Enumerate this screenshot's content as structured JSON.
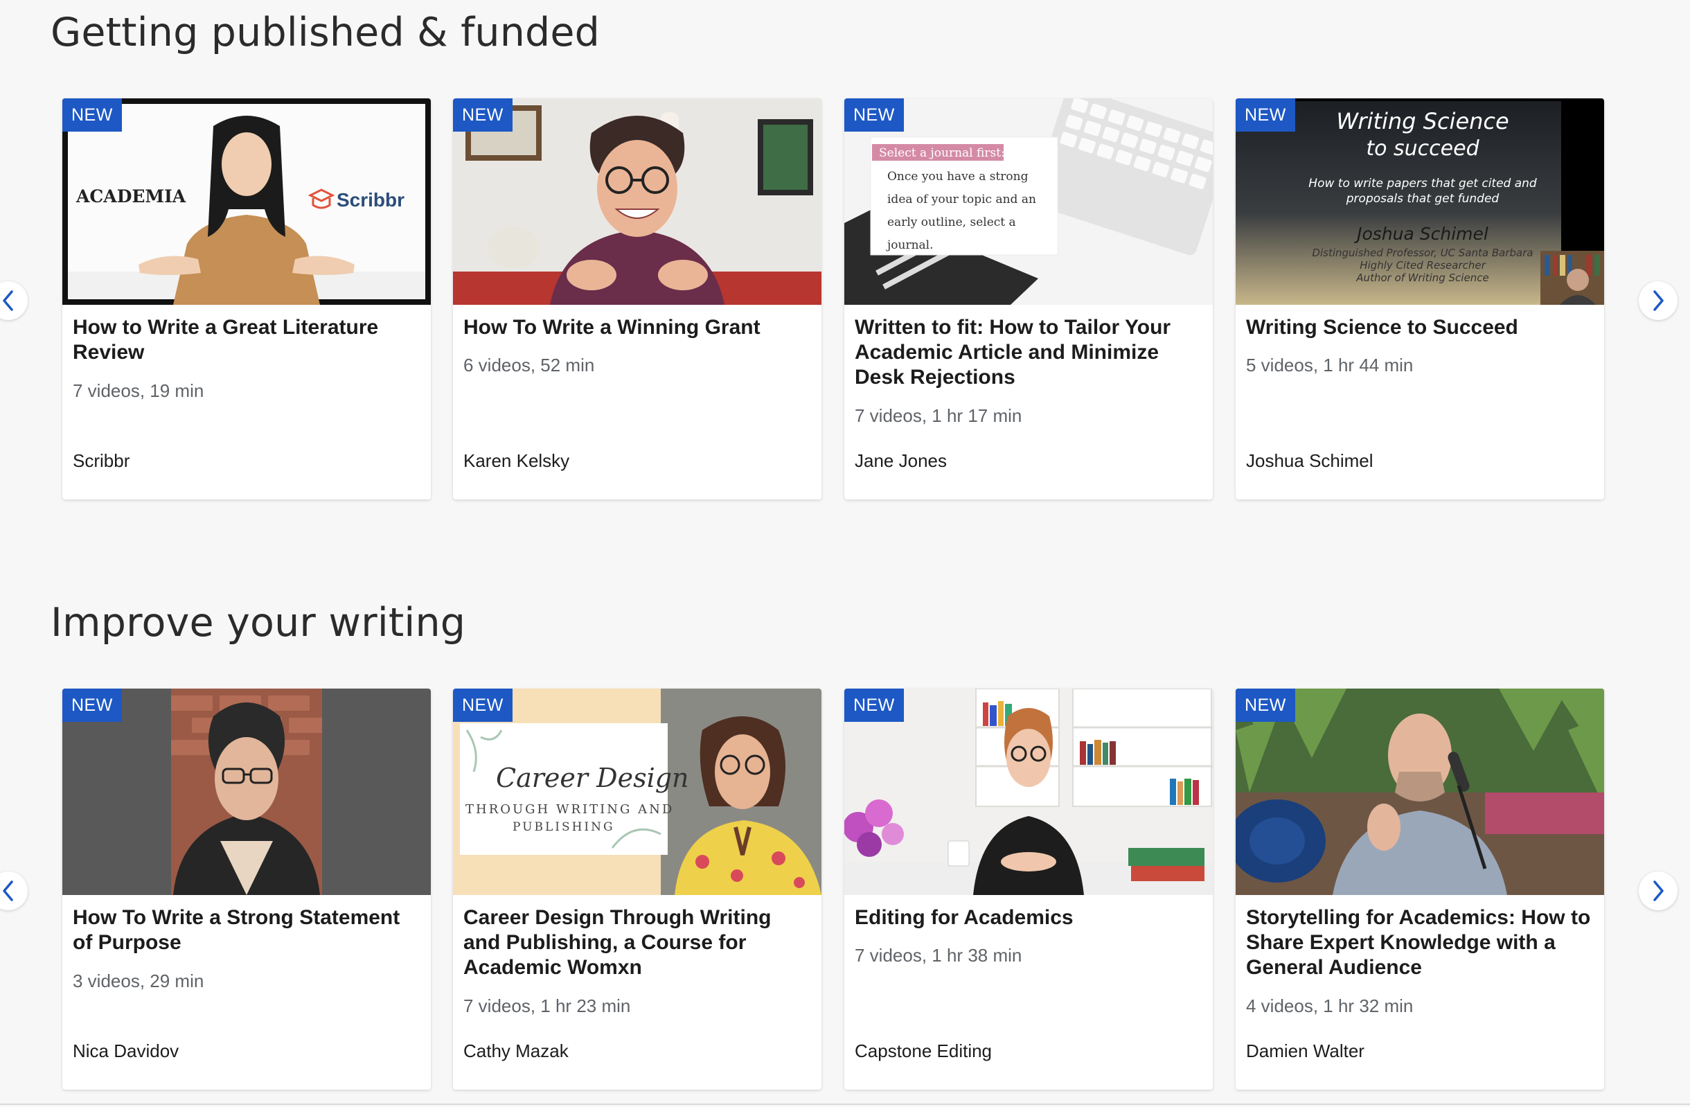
{
  "sections": [
    {
      "title": "Getting published & funded",
      "cards": [
        {
          "badge": "NEW",
          "title": "How to Write a Great Literature Review",
          "meta": "7 videos, 19 min",
          "author": "Scribbr",
          "thumb_text": {
            "left": "ACADEMIA",
            "brand": "Scribbr"
          }
        },
        {
          "badge": "NEW",
          "title": "How To Write a Winning Grant",
          "meta": "6 videos, 52 min",
          "author": "Karen Kelsky"
        },
        {
          "badge": "NEW",
          "title": "Written to fit: How to Tailor Your Academic Article and Minimize Desk Rejections",
          "meta": "7 videos, 1 hr 17 min",
          "author": "Jane Jones",
          "thumb_text": {
            "tag": "Select a journal first:",
            "body": [
              "Once you have a strong",
              "idea of your topic and an",
              "early outline, select a",
              "journal."
            ]
          }
        },
        {
          "badge": "NEW",
          "title": "Writing Science to Succeed",
          "meta": "5 videos, 1 hr 44 min",
          "author": "Joshua Schimel",
          "thumb_text": {
            "h1": "Writing Science",
            "h2": "to succeed",
            "sub1": "How to write papers that get cited and",
            "sub2": "proposals that get funded",
            "name": "Joshua Schimel",
            "c1": "Distinguished Professor, UC Santa Barbara",
            "c2": "Highly Cited Researcher",
            "c3": "Author of Writing Science"
          }
        }
      ]
    },
    {
      "title": "Improve your writing",
      "cards": [
        {
          "badge": "NEW",
          "title": "How To Write a Strong Statement of Purpose",
          "meta": "3 videos, 29 min",
          "author": "Nica Davidov"
        },
        {
          "badge": "NEW",
          "title": "Career Design Through Writing and Publishing, a Course for Academic Womxn",
          "meta": "7 videos, 1 hr 23 min",
          "author": "Cathy Mazak",
          "thumb_text": {
            "script": "Career Design",
            "line1": "THROUGH WRITING AND",
            "line2": "PUBLISHING"
          }
        },
        {
          "badge": "NEW",
          "title": "Editing for Academics",
          "meta": "7 videos, 1 hr 38 min",
          "author": "Capstone Editing"
        },
        {
          "badge": "NEW",
          "title": "Storytelling for Academics: How to Share Expert Knowledge with a General Audience",
          "meta": "4 videos, 1 hr 32 min",
          "author": "Damien Walter"
        }
      ]
    }
  ],
  "colors": {
    "badge": "#1d58c4",
    "arrow": "#1d58c4",
    "background": "#f7f7f7"
  },
  "icons": {
    "prev": "chevron-left-icon",
    "next": "chevron-right-icon"
  }
}
